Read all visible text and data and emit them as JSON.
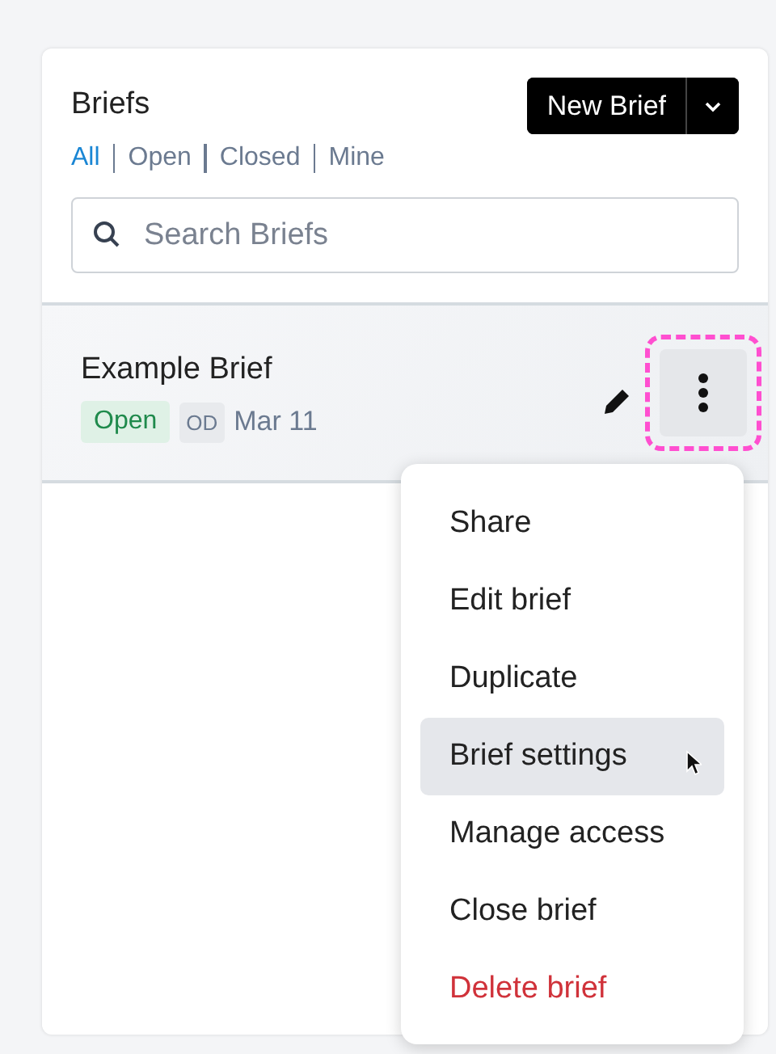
{
  "panel": {
    "title": "Briefs",
    "new_button": {
      "label": "New Brief"
    },
    "filters": [
      {
        "label": "All",
        "selected": true
      },
      {
        "label": "Open",
        "selected": false
      },
      {
        "label": "Closed",
        "selected": false
      },
      {
        "label": "Mine",
        "selected": false
      }
    ],
    "search": {
      "placeholder": "Search Briefs"
    },
    "briefs": [
      {
        "title": "Example Brief",
        "status": "Open",
        "initials": "OD",
        "date": "Mar 11",
        "menu_highlighted": true
      }
    ]
  },
  "menu": {
    "items": [
      {
        "label": "Share",
        "kind": "normal",
        "selected": false
      },
      {
        "label": "Edit brief",
        "kind": "normal",
        "selected": false
      },
      {
        "label": "Duplicate",
        "kind": "normal",
        "selected": false
      },
      {
        "label": "Brief settings",
        "kind": "normal",
        "selected": true
      },
      {
        "label": "Manage access",
        "kind": "normal",
        "selected": false
      },
      {
        "label": "Close brief",
        "kind": "normal",
        "selected": false
      },
      {
        "label": "Delete brief",
        "kind": "danger",
        "selected": false
      }
    ]
  }
}
